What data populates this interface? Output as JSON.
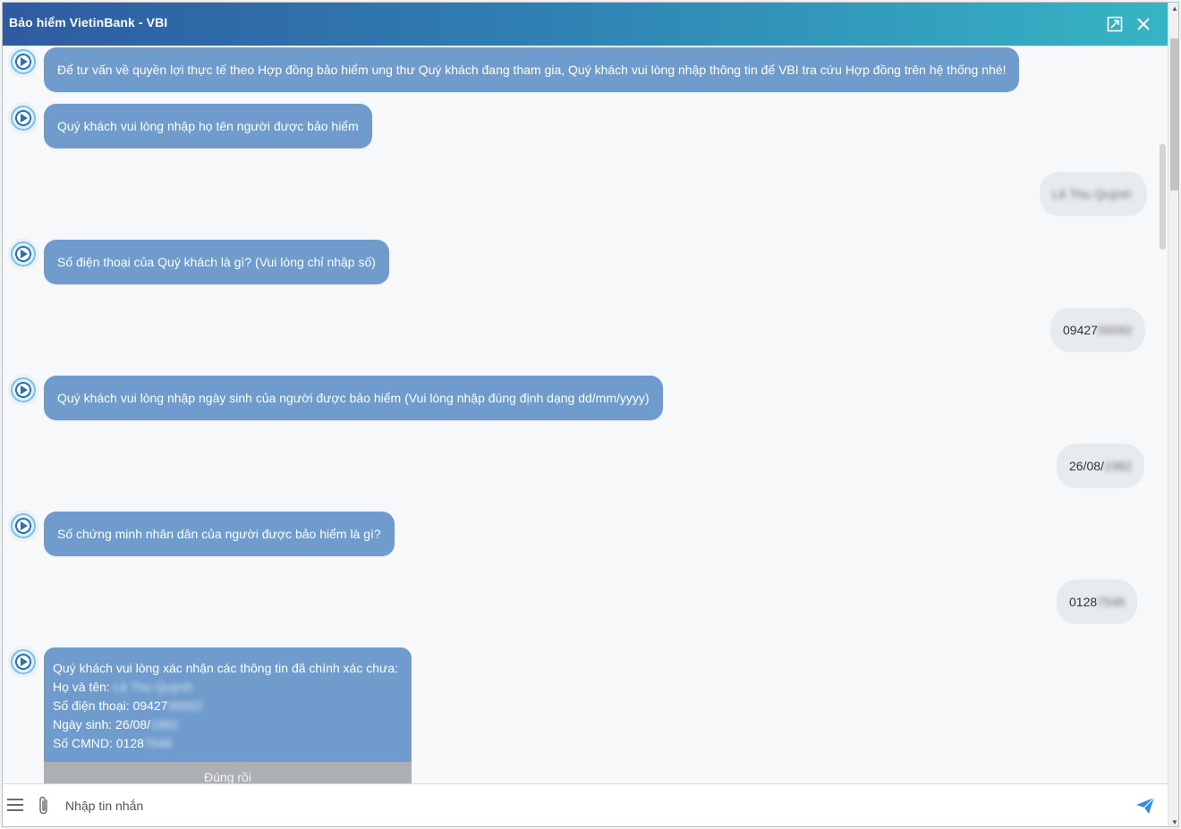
{
  "window": {
    "title": "Bảo hiểm VietinBank - VBI"
  },
  "messages": [
    {
      "from": "bot",
      "text": "Để tư vấn về quyền lợi thực tế theo Hợp đồng bảo hiểm ung thư Quý khách đang tham gia, Quý khách vui lòng nhập thông tin để VBI tra cứu Hợp đồng trên hệ thống nhé!"
    },
    {
      "from": "bot",
      "text": "Quý khách vui lòng nhập họ tên người được bảo hiểm"
    },
    {
      "from": "user",
      "visible": "",
      "hidden": "Lê Thu Quỳnh"
    },
    {
      "from": "bot",
      "text": "Số điện thoại của Quý khách là gì? (Vui lòng chỉ nhập số)"
    },
    {
      "from": "user",
      "visible": "09427",
      "hidden": "00092"
    },
    {
      "from": "bot",
      "text": "Quý khách vui lòng nhập ngày sinh của người được bảo hiểm (Vui lòng nhập đúng định dạng dd/mm/yyyy)"
    },
    {
      "from": "user",
      "visible": "26/08/",
      "hidden": "1982"
    },
    {
      "from": "bot",
      "text": "Số chứng minh nhân dân của người được bảo hiểm là gì?"
    },
    {
      "from": "user",
      "visible": "0128",
      "hidden": "7546"
    }
  ],
  "confirm": {
    "heading": "Quý khách vui lòng xác nhận các thông tin đã chính xác chưa:",
    "name_label": "Họ và tên: ",
    "name_hidden": "Lê Thu Quỳnh",
    "phone_label": "Số điện thoại: 09427",
    "phone_hidden": "00092",
    "dob_label": "Ngày sinh: 26/08/",
    "dob_hidden": "1982",
    "id_label": "Số CMND: 0128",
    "id_hidden": "7546",
    "button": "Đúng rồi"
  },
  "composer": {
    "placeholder": "Nhập tin nhắn"
  },
  "colors": {
    "bot_bubble": "#6f9ccd",
    "user_bubble": "#e8ebee",
    "title_gradient_start": "#2f5ba0",
    "title_gradient_end": "#36b4c4",
    "send_icon": "#2f8fd8"
  },
  "icons": [
    "expand-icon",
    "close-icon",
    "bot-avatar-icon",
    "menu-icon",
    "attach-icon",
    "send-icon"
  ]
}
